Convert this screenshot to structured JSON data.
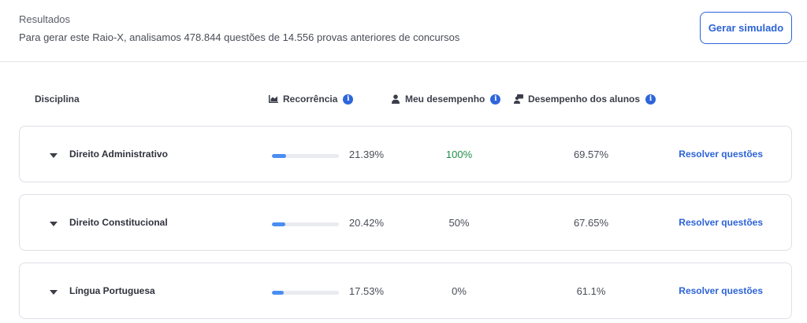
{
  "header": {
    "title": "Resultados",
    "subtitle": "Para gerar este Raio-X, analisamos 478.844 questões de 14.556 provas anteriores de concursos",
    "button_label": "Gerar simulado"
  },
  "columns": {
    "disciplina": "Disciplina",
    "recorrencia": "Recorrência",
    "meu_desempenho": "Meu desempenho",
    "desempenho_alunos": "Desempenho dos alunos",
    "info_glyph": "i"
  },
  "rows": [
    {
      "disciplina": "Direito Administrativo",
      "recorrencia": "21.39%",
      "recorrencia_value": 21.39,
      "meu": "100%",
      "alunos": "69.57%",
      "action": "Resolver questões"
    },
    {
      "disciplina": "Direito Constitucional",
      "recorrencia": "20.42%",
      "recorrencia_value": 20.42,
      "meu": "50%",
      "alunos": "67.65%",
      "action": "Resolver questões"
    },
    {
      "disciplina": "Língua Portuguesa",
      "recorrencia": "17.53%",
      "recorrencia_value": 17.53,
      "meu": "0%",
      "alunos": "61.1%",
      "action": "Resolver questões"
    }
  ],
  "colors": {
    "accent": "#2c63d6",
    "bar": "#4a8ef2",
    "good": "#1f8f48"
  },
  "icons": [
    "chart-icon",
    "user-icon",
    "users-icon",
    "info-icon",
    "caret-down-icon"
  ]
}
